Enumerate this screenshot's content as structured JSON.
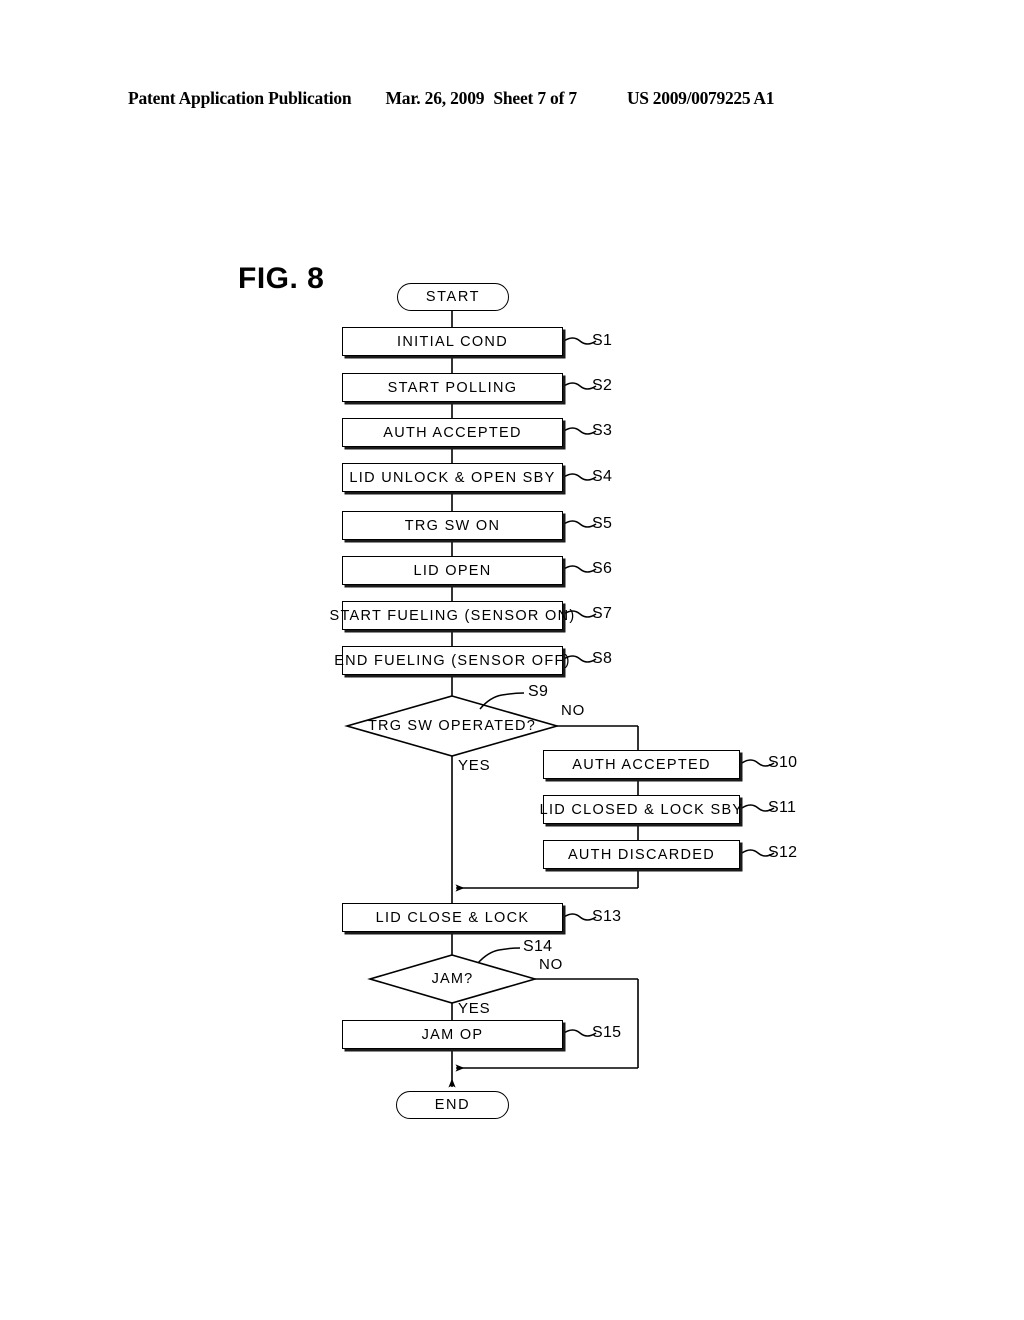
{
  "header": {
    "publication": "Patent Application Publication",
    "date": "Mar. 26, 2009",
    "sheet": "Sheet 7 of 7",
    "pub_number": "US 2009/0079225 A1"
  },
  "figure": {
    "label": "FIG. 8",
    "start_label": "START",
    "end_label": "END"
  },
  "branch_labels": {
    "s9_no": "NO",
    "s9_yes": "YES",
    "s14_no": "NO",
    "s14_yes": "YES"
  },
  "steps": [
    {
      "id": "S1",
      "ref": "S1",
      "text": "INITIAL COND",
      "type": "process"
    },
    {
      "id": "S2",
      "ref": "S2",
      "text": "START POLLING",
      "type": "process"
    },
    {
      "id": "S3",
      "ref": "S3",
      "text": "AUTH ACCEPTED",
      "type": "process"
    },
    {
      "id": "S4",
      "ref": "S4",
      "text": "LID UNLOCK & OPEN SBY",
      "type": "process"
    },
    {
      "id": "S5",
      "ref": "S5",
      "text": "TRG SW ON",
      "type": "process"
    },
    {
      "id": "S6",
      "ref": "S6",
      "text": "LID OPEN",
      "type": "process"
    },
    {
      "id": "S7",
      "ref": "S7",
      "text": "START FUELING (SENSOR ON)",
      "type": "process"
    },
    {
      "id": "S8",
      "ref": "S8",
      "text": "END FUELING (SENSOR OFF)",
      "type": "process"
    },
    {
      "id": "S9",
      "ref": "S9",
      "text": "TRG SW OPERATED?",
      "type": "decision"
    },
    {
      "id": "S10",
      "ref": "S10",
      "text": "AUTH ACCEPTED",
      "type": "process"
    },
    {
      "id": "S11",
      "ref": "S11",
      "text": "LID CLOSED & LOCK SBY",
      "type": "process"
    },
    {
      "id": "S12",
      "ref": "S12",
      "text": "AUTH DISCARDED",
      "type": "process"
    },
    {
      "id": "S13",
      "ref": "S13",
      "text": "LID CLOSE & LOCK",
      "type": "process"
    },
    {
      "id": "S14",
      "ref": "S14",
      "text": "JAM?",
      "type": "decision"
    },
    {
      "id": "S15",
      "ref": "S15",
      "text": "JAM OP",
      "type": "process"
    }
  ],
  "colors": {
    "ink": "#000000",
    "paper": "#ffffff"
  }
}
